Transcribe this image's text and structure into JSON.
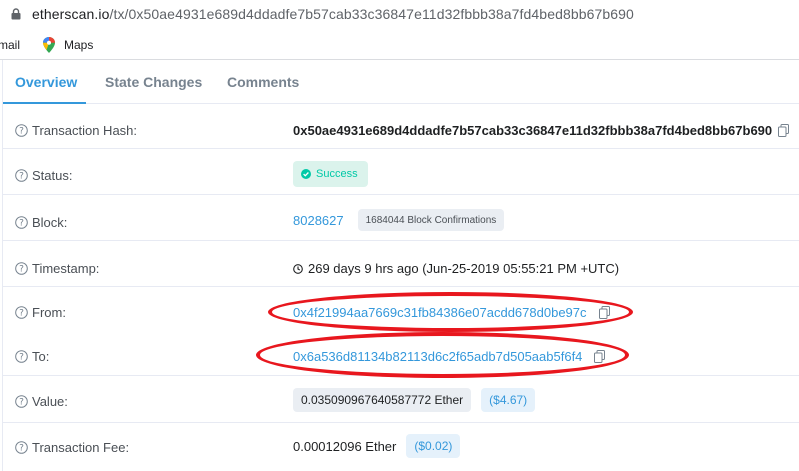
{
  "browser": {
    "url_host": "etherscan.io",
    "url_path": "/tx/0x50ae4931e689d4ddadfe7b57cab33c36847e11d32fbbb38a7fd4bed8bb67b690",
    "bookmarks": [
      {
        "label": "mail"
      },
      {
        "label": "Maps"
      }
    ]
  },
  "tabs": [
    {
      "label": "Overview",
      "active": true
    },
    {
      "label": "State Changes"
    },
    {
      "label": "Comments"
    }
  ],
  "fields": {
    "tx_hash": {
      "label": "Transaction Hash:",
      "value": "0x50ae4931e689d4ddadfe7b57cab33c36847e11d32fbbb38a7fd4bed8bb67b690"
    },
    "status": {
      "label": "Status:",
      "value": "Success"
    },
    "block": {
      "label": "Block:",
      "value": "8028627",
      "confirmations": "1684044 Block Confirmations"
    },
    "timestamp": {
      "label": "Timestamp:",
      "value": "269 days 9 hrs ago (Jun-25-2019 05:55:21 PM +UTC)"
    },
    "from": {
      "label": "From:",
      "value": "0x4f21994aa7669c31fb84386e07acdd678d0be97c"
    },
    "to": {
      "label": "To:",
      "value": "0x6a536d81134b82113d6c2f65adb7d505aab5f6f4"
    },
    "value": {
      "label": "Value:",
      "value": "0.035090967640587772 Ether",
      "usd": "($4.67)"
    },
    "fee": {
      "label": "Transaction Fee:",
      "value": "0.00012096 Ether",
      "usd": "($0.02)"
    }
  },
  "colors": {
    "accent": "#3498db",
    "success": "#00c9a7",
    "annotation": "#e8171e"
  }
}
